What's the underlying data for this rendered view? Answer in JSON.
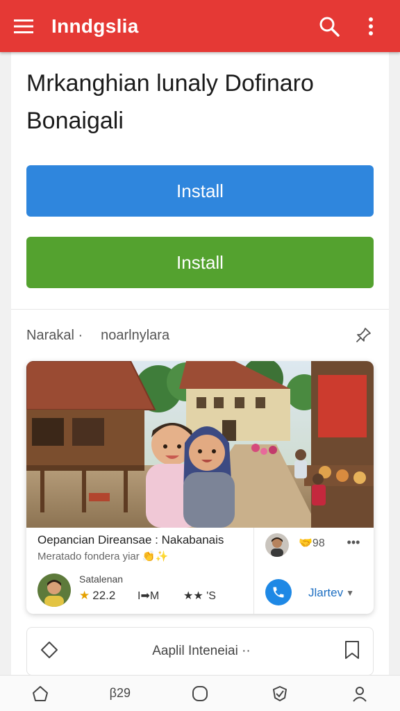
{
  "appbar": {
    "title": "Inndgslia",
    "menu_icon": "hamburger-menu-icon",
    "search_icon": "search-icon",
    "more_icon": "more-vert-icon",
    "color": "#e53935"
  },
  "main": {
    "headline": "Mrkanghian lunaly Dofinaro Bonaigali",
    "buttons": [
      {
        "label": "Install",
        "color": "#2f86dd"
      },
      {
        "label": "Install",
        "color": "#54a22f"
      }
    ],
    "tabs": [
      "Narakal ·",
      "noarlnylara"
    ],
    "pin_icon": "pin-icon"
  },
  "card": {
    "title": "Oepancian Direansae : Nakabanais",
    "subtitle": "Meratado fondera yiar",
    "subtitle_emoji": "👏✨",
    "user_name": "Satalenan",
    "rating": "22.2",
    "indicator": "I➡M",
    "rating2": "★★ 'S",
    "likes": "🤝98",
    "more": "•••",
    "status": "Jlartev"
  },
  "app_row": {
    "label": "Aaplil Inteneiai ··"
  },
  "bottomnav": {
    "items": [
      {
        "icon": "home-icon",
        "label": ""
      },
      {
        "icon": "",
        "label": "β29"
      },
      {
        "icon": "circle-icon",
        "label": ""
      },
      {
        "icon": "shield-check-icon",
        "label": ""
      },
      {
        "icon": "person-icon",
        "label": ""
      }
    ]
  }
}
